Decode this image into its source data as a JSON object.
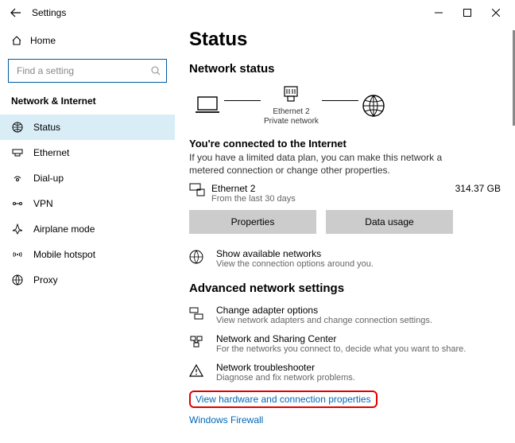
{
  "titlebar": {
    "title": "Settings"
  },
  "sidebar": {
    "home_label": "Home",
    "search_placeholder": "Find a setting",
    "heading": "Network & Internet",
    "items": [
      {
        "label": "Status"
      },
      {
        "label": "Ethernet"
      },
      {
        "label": "Dial-up"
      },
      {
        "label": "VPN"
      },
      {
        "label": "Airplane mode"
      },
      {
        "label": "Mobile hotspot"
      },
      {
        "label": "Proxy"
      }
    ]
  },
  "main": {
    "title": "Status",
    "network_status_heading": "Network status",
    "diagram": {
      "conn_name": "Ethernet 2",
      "conn_type": "Private network"
    },
    "connected_heading": "You're connected to the Internet",
    "connected_body": "If you have a limited data plan, you can make this network a metered connection or change other properties.",
    "conn": {
      "name": "Ethernet 2",
      "sub": "From the last 30 days",
      "usage": "314.37 GB"
    },
    "btn_properties": "Properties",
    "btn_datausage": "Data usage",
    "show_nets": {
      "title": "Show available networks",
      "desc": "View the connection options around you."
    },
    "adv_heading": "Advanced network settings",
    "adv": [
      {
        "title": "Change adapter options",
        "desc": "View network adapters and change connection settings."
      },
      {
        "title": "Network and Sharing Center",
        "desc": "For the networks you connect to, decide what you want to share."
      },
      {
        "title": "Network troubleshooter",
        "desc": "Diagnose and fix network problems."
      }
    ],
    "link_hw": "View hardware and connection properties",
    "link_fw": "Windows Firewall"
  }
}
